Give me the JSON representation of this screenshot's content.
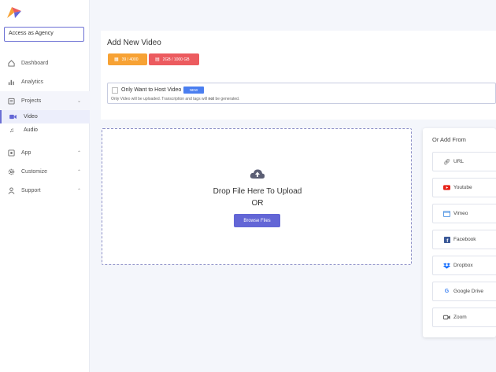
{
  "sidebar": {
    "agency_button": "Access as Agency",
    "items": [
      {
        "label": "Dashboard",
        "icon": "home-icon"
      },
      {
        "label": "Analytics",
        "icon": "bar-chart-icon"
      },
      {
        "label": "Projects",
        "icon": "folder-icon"
      },
      {
        "label": "App",
        "icon": "app-icon"
      },
      {
        "label": "Customize",
        "icon": "gear-icon"
      },
      {
        "label": "Support",
        "icon": "user-icon"
      }
    ],
    "sub_items": [
      {
        "label": "Video",
        "icon": "video-icon"
      },
      {
        "label": "Audio",
        "icon": "music-icon"
      }
    ]
  },
  "header": {
    "title": "Add New Video",
    "videos_badge": "39 / 4000",
    "storage_badge": "2GB / 1000 GB"
  },
  "host": {
    "label": "Only Want to Host Video",
    "new_badge": "NEW",
    "note_before": "Only Video will be uploaded. Transcription and tags will ",
    "note_bold": "not",
    "note_after": " be generated."
  },
  "upload": {
    "drop_text": "Drop File Here To Upload",
    "or_text": "OR",
    "browse_label": "Browse Files"
  },
  "add_from": {
    "title": "Or Add From",
    "sources": [
      {
        "label": "URL",
        "icon": "link-icon",
        "color": "#555555"
      },
      {
        "label": "Youtube",
        "icon": "youtube-icon",
        "color": "#e62117"
      },
      {
        "label": "Vimeo",
        "icon": "vimeo-icon",
        "color": "#4a90e2"
      },
      {
        "label": "Facebook",
        "icon": "facebook-icon",
        "color": "#3b5998"
      },
      {
        "label": "Dropbox",
        "icon": "dropbox-icon",
        "color": "#0061fe"
      },
      {
        "label": "Google Drive",
        "icon": "google-icon",
        "color": "#4285f4"
      },
      {
        "label": "Zoom",
        "icon": "zoom-icon",
        "color": "#555555"
      }
    ]
  },
  "colors": {
    "accent": "#6366d6",
    "badge_orange": "#f7a234",
    "badge_red": "#ec5b5f",
    "new_badge": "#4a7ef0"
  }
}
